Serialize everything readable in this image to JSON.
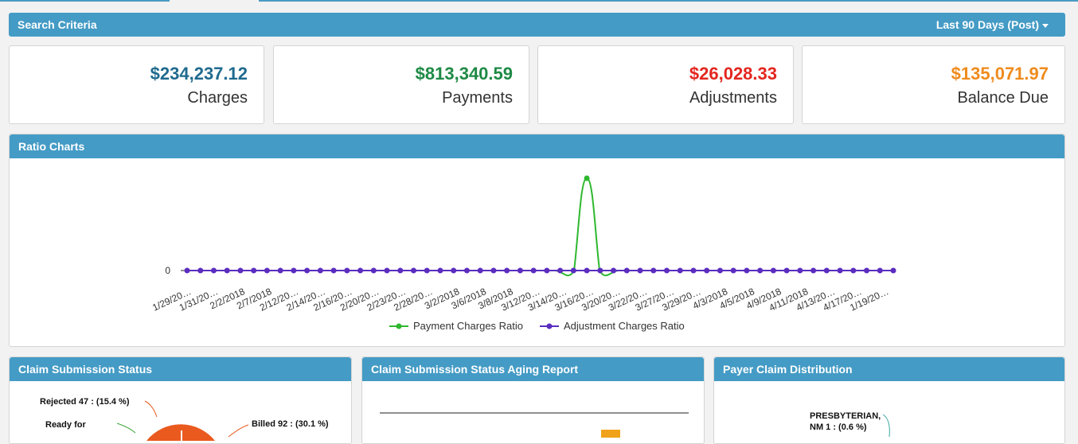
{
  "search": {
    "title": "Search Criteria",
    "range": "Last 90 Days (Post)"
  },
  "stats": [
    {
      "amount": "$234,237.12",
      "label": "Charges",
      "color": "#1f6a8e"
    },
    {
      "amount": "$813,340.59",
      "label": "Payments",
      "color": "#1e8a45"
    },
    {
      "amount": "$26,028.33",
      "label": "Adjustments",
      "color": "#e3261f"
    },
    {
      "amount": "$135,071.97",
      "label": "Balance Due",
      "color": "#ef8b1d"
    }
  ],
  "ratio": {
    "title": "Ratio Charts",
    "chart_data": {
      "type": "line",
      "categories": [
        "1/29/20…",
        "1/31/20…",
        "2/2/2018",
        "2/7/2018",
        "2/12/20…",
        "2/14/20…",
        "2/16/20…",
        "2/20/20…",
        "2/23/20…",
        "2/28/20…",
        "3/2/2018",
        "3/6/2018",
        "3/8/2018",
        "3/12/20…",
        "3/14/20…",
        "3/16/20…",
        "3/20/20…",
        "3/22/20…",
        "3/27/20…",
        "3/29/20…",
        "4/3/2018",
        "4/5/2018",
        "4/9/2018",
        "4/11/2018",
        "4/13/20…",
        "4/17/20…",
        "1/19/20…"
      ],
      "y_tick_labels": [
        "0"
      ],
      "series": [
        {
          "name": "Payment Charges Ratio",
          "color": "#2fb82f",
          "spike_index": 30,
          "spike_value": 7,
          "values_note_points": 54
        },
        {
          "name": "Adjustment Charges Ratio",
          "color": "#5b2dbf"
        }
      ],
      "point_count": 54,
      "legend": "bottom-center"
    }
  },
  "panels": {
    "claim": {
      "title": "Claim Submission Status",
      "labels": {
        "rejected": "Rejected 47 : (15.4 %)",
        "ready": "Ready for",
        "billed": "Billed 92 : (30.1 %)"
      }
    },
    "aging": {
      "title": "Claim Submission Status Aging Report"
    },
    "payer": {
      "title": "Payer Claim Distribution",
      "label_line1": "PRESBYTERIAN,",
      "label_line2": "NM 1 : (0.6 %)"
    }
  }
}
